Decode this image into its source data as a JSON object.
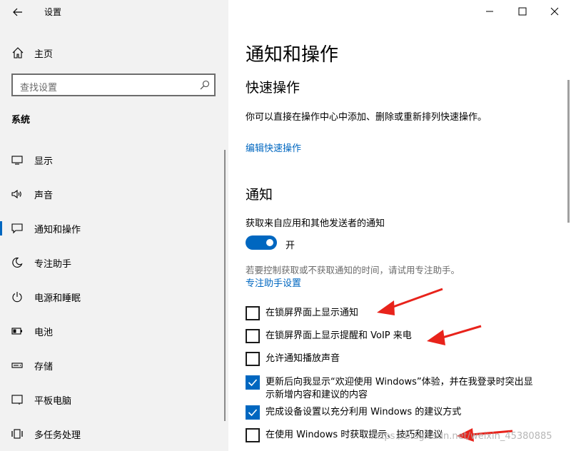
{
  "window": {
    "title": "设置",
    "accent": "#0067c0"
  },
  "sidebar": {
    "home_label": "主页",
    "search_placeholder": "查找设置",
    "section": "系统",
    "items": [
      {
        "label": "显示",
        "icon": "monitor-icon",
        "active": false
      },
      {
        "label": "声音",
        "icon": "speaker-icon",
        "active": false
      },
      {
        "label": "通知和操作",
        "icon": "notification-icon",
        "active": true
      },
      {
        "label": "专注助手",
        "icon": "moon-icon",
        "active": false
      },
      {
        "label": "电源和睡眠",
        "icon": "power-icon",
        "active": false
      },
      {
        "label": "电池",
        "icon": "battery-icon",
        "active": false
      },
      {
        "label": "存储",
        "icon": "storage-icon",
        "active": false
      },
      {
        "label": "平板电脑",
        "icon": "tablet-icon",
        "active": false
      },
      {
        "label": "多任务处理",
        "icon": "multitask-icon",
        "active": false
      }
    ]
  },
  "main": {
    "title": "通知和操作",
    "quick_actions": {
      "heading": "快速操作",
      "description": "你可以直接在操作中心中添加、删除或重新排列快速操作。",
      "edit_link": "编辑快速操作"
    },
    "notifications": {
      "heading": "通知",
      "get_label": "获取来自应用和其他发送者的通知",
      "toggle_state": "开",
      "toggle_on": true,
      "focus_hint": "若要控制获取或不获取通知的时间，请试用专注助手。",
      "focus_link": "专注助手设置",
      "checkboxes": [
        {
          "label": "在锁屏界面上显示通知",
          "checked": false
        },
        {
          "label": "在锁屏界面上显示提醒和 VoIP 来电",
          "checked": false
        },
        {
          "label": "允许通知播放声音",
          "checked": false
        },
        {
          "label": "更新后向我显示“欢迎使用 Windows”体验，并在我登录时突出显示新增内容和建议的内容",
          "line1": "更新后向我显示“欢迎使用 Windows”体验，并在我登录时突出显",
          "line2": "示新增内容和建议的内容",
          "checked": true
        },
        {
          "label": "完成设备设置以充分利用 Windows 的建议方式",
          "checked": true
        },
        {
          "label": "在使用 Windows 时获取提示、技巧和建议",
          "checked": false
        }
      ]
    }
  },
  "watermark": "https://blog.csdn.net/weixin_45380885",
  "annotation_color": "#e8231b"
}
